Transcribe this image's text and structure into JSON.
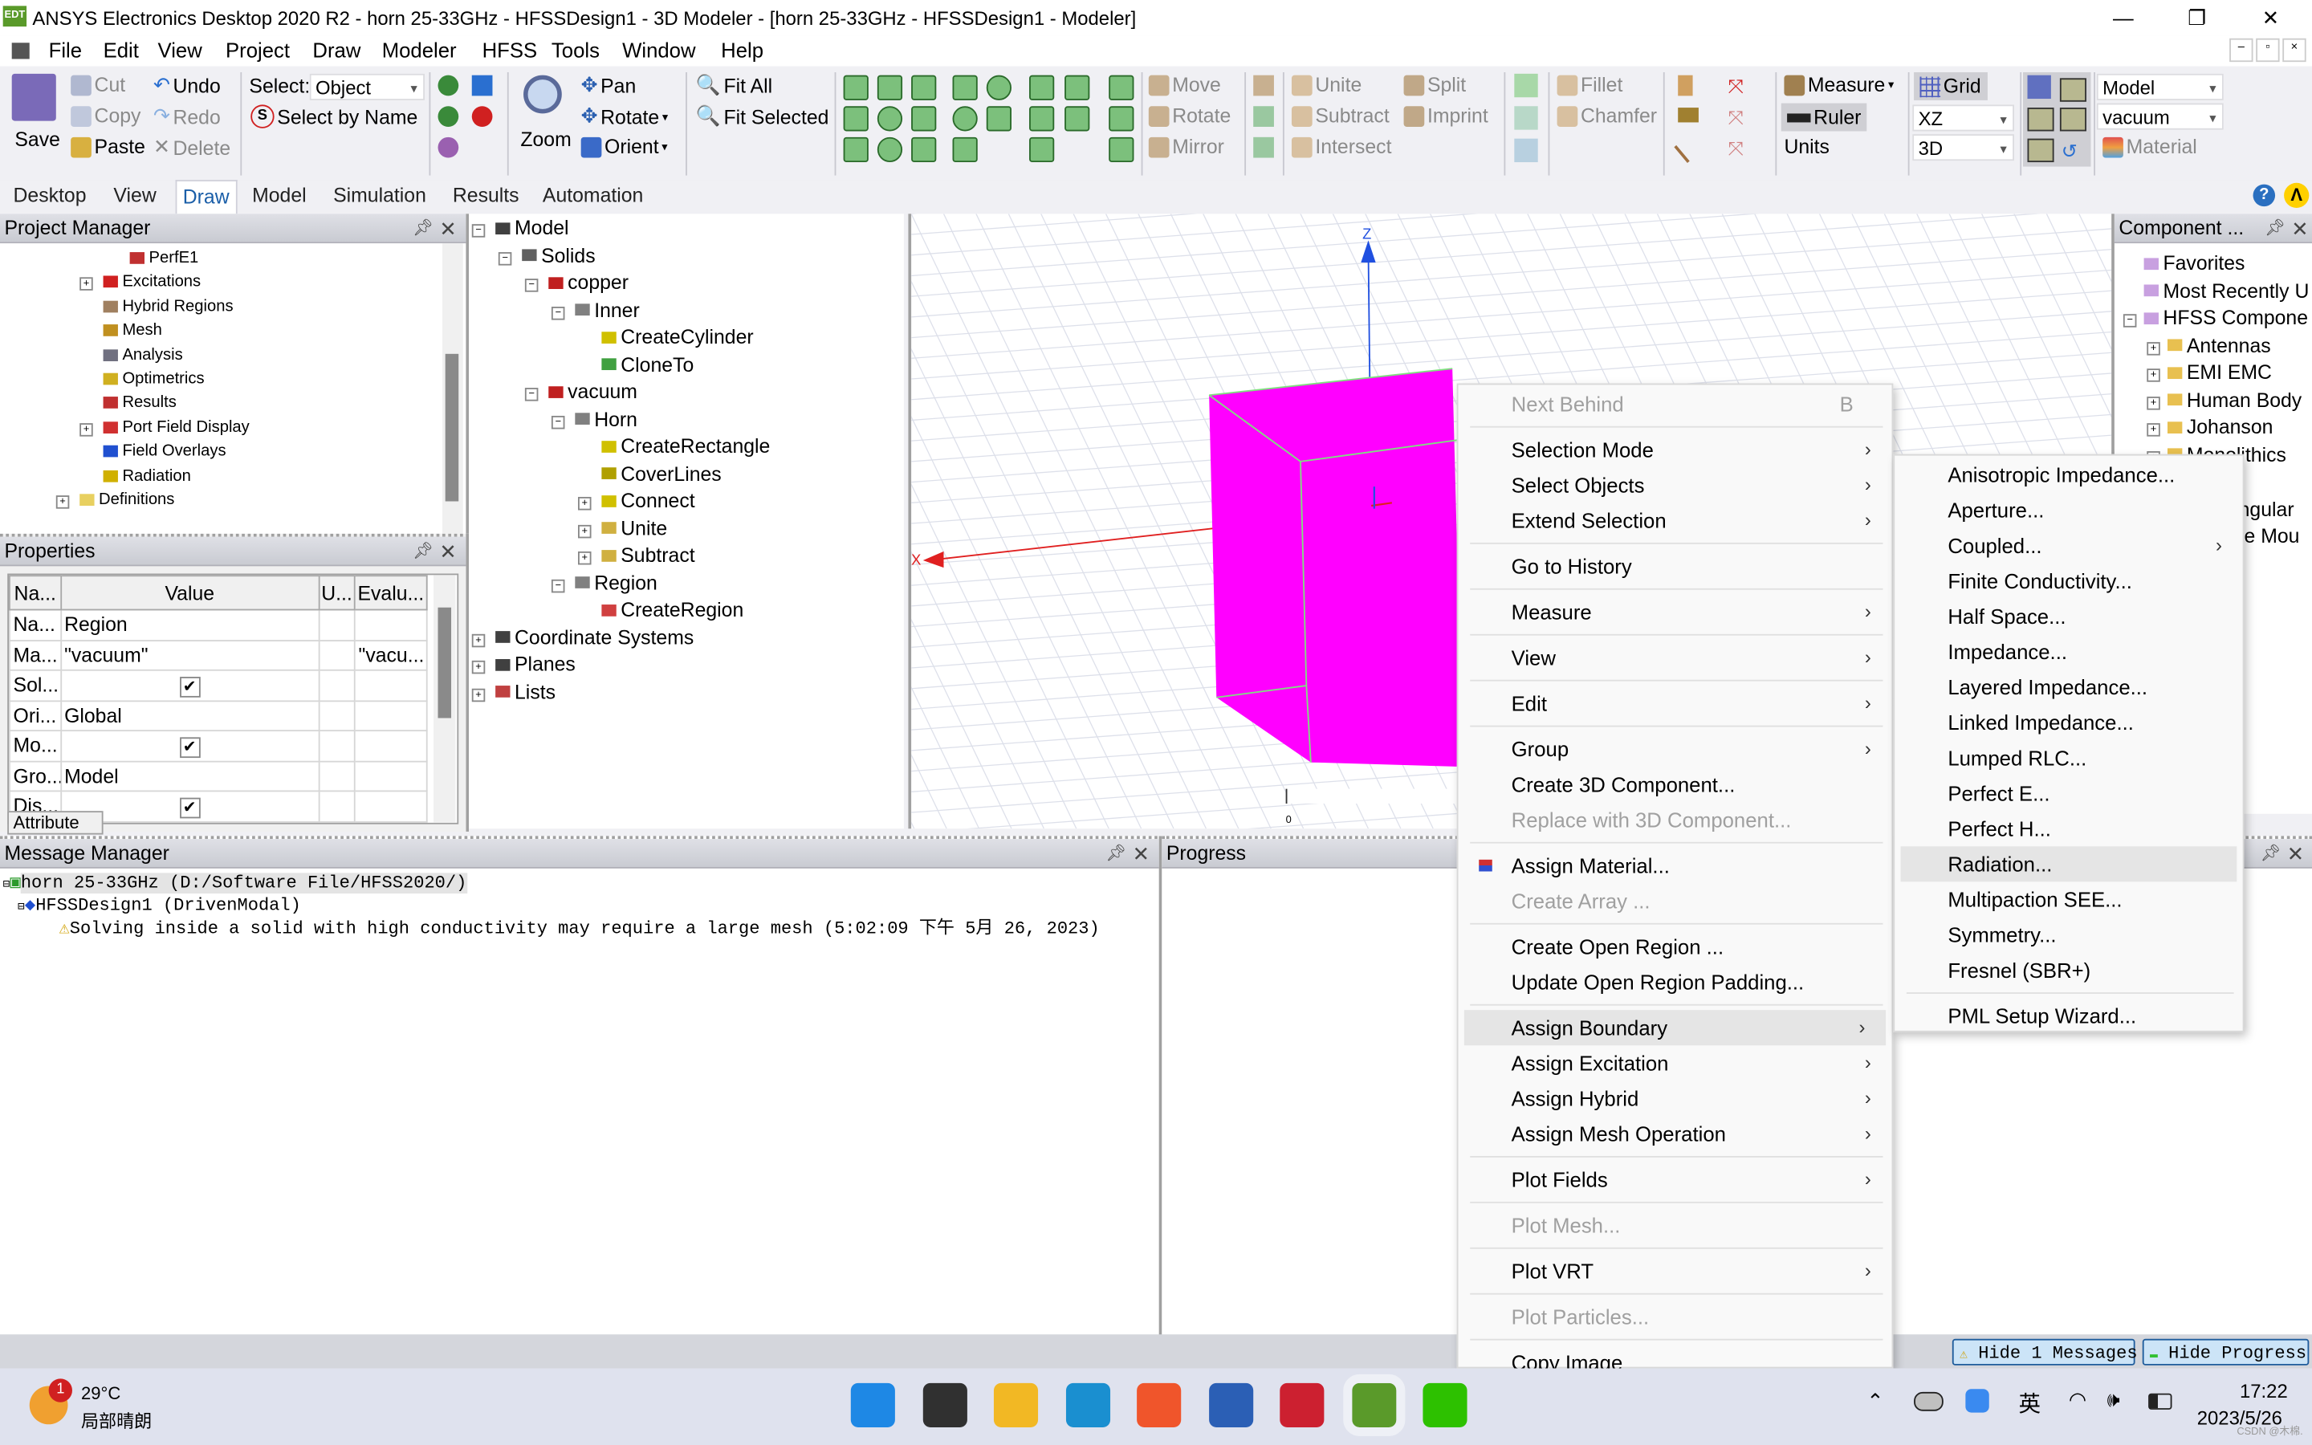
{
  "window": {
    "title": "ANSYS Electronics Desktop 2020 R2 - horn 25-33GHz - HFSSDesign1 - 3D Modeler - [horn 25-33GHz - HFSSDesign1 - Modeler]",
    "app_icon_text": "EDT",
    "minimize": "—",
    "restore": "❐",
    "close": "✕"
  },
  "menu": [
    "File",
    "Edit",
    "View",
    "Project",
    "Draw",
    "Modeler",
    "HFSS",
    "Tools",
    "Window",
    "Help"
  ],
  "ribbon": {
    "save": "Save",
    "cut": "Cut",
    "copy": "Copy",
    "paste": "Paste",
    "undo": "Undo",
    "redo": "Redo",
    "delete": "Delete",
    "select_label": "Select:",
    "select_value": "Object",
    "select_by_name": "Select by Name",
    "zoom": "Zoom",
    "pan": "Pan",
    "rotate": "Rotate",
    "orient": "Orient",
    "fit_all": "Fit All",
    "fit_selected": "Fit Selected",
    "move": "Move",
    "rotate2": "Rotate",
    "mirror": "Mirror",
    "unite": "Unite",
    "subtract": "Subtract",
    "intersect": "Intersect",
    "split": "Split",
    "imprint": "Imprint",
    "fillet": "Fillet",
    "chamfer": "Chamfer",
    "measure": "Measure",
    "ruler": "Ruler",
    "units": "Units",
    "grid": "Grid",
    "plane_value": "XZ",
    "view_value": "3D",
    "model_value": "Model",
    "material_value": "vacuum",
    "material": "Material"
  },
  "tabs": [
    {
      "label": "Desktop",
      "active": false
    },
    {
      "label": "View",
      "active": false
    },
    {
      "label": "Draw",
      "active": true
    },
    {
      "label": "Model",
      "active": false
    },
    {
      "label": "Simulation",
      "active": false
    },
    {
      "label": "Results",
      "active": false
    },
    {
      "label": "Automation",
      "active": false
    }
  ],
  "project_manager": {
    "title": "Project Manager",
    "items": [
      {
        "label": "PerfE1",
        "level": 3,
        "color": "#c03030"
      },
      {
        "label": "Excitations",
        "level": 2,
        "expandable": true,
        "color": "#d02020"
      },
      {
        "label": "Hybrid Regions",
        "level": 2,
        "color": "#a08060"
      },
      {
        "label": "Mesh",
        "level": 2,
        "color": "#c09020"
      },
      {
        "label": "Analysis",
        "level": 2,
        "color": "#707080"
      },
      {
        "label": "Optimetrics",
        "level": 2,
        "color": "#d0b020"
      },
      {
        "label": "Results",
        "level": 2,
        "color": "#c03030"
      },
      {
        "label": "Port Field Display",
        "level": 2,
        "expandable": true,
        "color": "#d03030"
      },
      {
        "label": "Field Overlays",
        "level": 2,
        "color": "#2050d0"
      },
      {
        "label": "Radiation",
        "level": 2,
        "color": "#d0b000"
      },
      {
        "label": "Definitions",
        "level": 1,
        "expandable": true,
        "color": "#e8d060"
      }
    ]
  },
  "properties": {
    "title": "Properties",
    "columns": [
      "Na...",
      "Value",
      "U...",
      "Evalu..."
    ],
    "rows": [
      {
        "name": "Na...",
        "value": "Region",
        "unit": "",
        "eval": ""
      },
      {
        "name": "Ma...",
        "value": "\"vacuum\"",
        "unit": "",
        "eval": "\"vacu..."
      },
      {
        "name": "Sol...",
        "checked": true,
        "unit": "",
        "eval": ""
      },
      {
        "name": "Ori...",
        "value": "Global",
        "unit": "",
        "eval": ""
      },
      {
        "name": "Mo...",
        "checked": true,
        "unit": "",
        "eval": ""
      },
      {
        "name": "Gro...",
        "value": "Model",
        "unit": "",
        "eval": ""
      },
      {
        "name": "Dis...",
        "checked": true,
        "unit": "",
        "eval": ""
      }
    ],
    "tab": "Attribute"
  },
  "model_tree": [
    {
      "label": "Model",
      "level": 0,
      "expandable": true,
      "color": "#404040"
    },
    {
      "label": "Solids",
      "level": 1,
      "expandable": true,
      "color": "#606060"
    },
    {
      "label": "copper",
      "level": 2,
      "expandable": true,
      "color": "#c02020"
    },
    {
      "label": "Inner",
      "level": 3,
      "expandable": true,
      "color": "#808080"
    },
    {
      "label": "CreateCylinder",
      "level": 4,
      "color": "#d0c000"
    },
    {
      "label": "CloneTo",
      "level": 4,
      "color": "#40a040"
    },
    {
      "label": "vacuum",
      "level": 2,
      "expandable": true,
      "color": "#c02020"
    },
    {
      "label": "Horn",
      "level": 3,
      "expandable": true,
      "color": "#808080"
    },
    {
      "label": "CreateRectangle",
      "level": 4,
      "color": "#d0c000"
    },
    {
      "label": "CoverLines",
      "level": 4,
      "color": "#b0a000"
    },
    {
      "label": "Connect",
      "level": 4,
      "expandable": true,
      "color": "#d0c000"
    },
    {
      "label": "Unite",
      "level": 4,
      "expandable": true,
      "color": "#d0b040"
    },
    {
      "label": "Subtract",
      "level": 4,
      "expandable": true,
      "color": "#d0b040"
    },
    {
      "label": "Region",
      "level": 3,
      "expandable": true,
      "color": "#808080"
    },
    {
      "label": "CreateRegion",
      "level": 4,
      "color": "#d04040"
    },
    {
      "label": "Coordinate Systems",
      "level": 0,
      "expandable": true,
      "color": "#404040"
    },
    {
      "label": "Planes",
      "level": 0,
      "expandable": true,
      "color": "#404040"
    },
    {
      "label": "Lists",
      "level": 0,
      "expandable": true,
      "color": "#c04040"
    }
  ],
  "viewport": {
    "axis_z": "Z",
    "axis_x": "X",
    "scale_zero": "0",
    "object_color": "#ff00ff"
  },
  "component_panel": {
    "title": "Component ...",
    "items": [
      {
        "label": "Favorites",
        "level": 0
      },
      {
        "label": "Most Recently U",
        "level": 0
      },
      {
        "label": "HFSS Compone",
        "level": 0,
        "expandable": true
      },
      {
        "label": "Antennas",
        "level": 1,
        "expandable": true
      },
      {
        "label": "EMI EMC",
        "level": 1,
        "expandable": true
      },
      {
        "label": "Human Body",
        "level": 1,
        "expandable": true
      },
      {
        "label": "Johanson",
        "level": 1,
        "expandable": true
      },
      {
        "label": "Monolithics",
        "level": 1,
        "expandable": true
      },
      {
        "label": "",
        "level": 1
      },
      {
        "label": "Rectangular",
        "level": 1,
        "expandable": true
      },
      {
        "label": "Surface Mou",
        "level": 1,
        "expandable": true
      }
    ]
  },
  "context_menu": [
    {
      "label": "Next Behind",
      "disabled": true,
      "shortcut": "B"
    },
    {
      "sep": true
    },
    {
      "label": "Selection Mode",
      "submenu": true
    },
    {
      "label": "Select Objects",
      "submenu": true
    },
    {
      "label": "Extend Selection",
      "submenu": true
    },
    {
      "sep": true
    },
    {
      "label": "Go to History"
    },
    {
      "sep": true
    },
    {
      "label": "Measure",
      "submenu": true
    },
    {
      "sep": true
    },
    {
      "label": "View",
      "submenu": true
    },
    {
      "sep": true
    },
    {
      "label": "Edit",
      "submenu": true
    },
    {
      "sep": true
    },
    {
      "label": "Group",
      "submenu": true
    },
    {
      "label": "Create 3D Component..."
    },
    {
      "label": "Replace with 3D Component...",
      "disabled": true
    },
    {
      "sep": true
    },
    {
      "label": "Assign Material...",
      "icon": "material-icon"
    },
    {
      "label": "Create Array ...",
      "disabled": true
    },
    {
      "sep": true
    },
    {
      "label": "Create Open Region ..."
    },
    {
      "label": "Update Open Region Padding..."
    },
    {
      "sep": true
    },
    {
      "label": "Assign Boundary",
      "submenu": true,
      "highlighted": true
    },
    {
      "label": "Assign Excitation",
      "submenu": true
    },
    {
      "label": "Assign Hybrid",
      "submenu": true
    },
    {
      "label": "Assign Mesh Operation",
      "submenu": true
    },
    {
      "sep": true
    },
    {
      "label": "Plot Fields",
      "submenu": true
    },
    {
      "sep": true
    },
    {
      "label": "Plot Mesh...",
      "disabled": true
    },
    {
      "sep": true
    },
    {
      "label": "Plot VRT",
      "submenu": true
    },
    {
      "sep": true
    },
    {
      "label": "Plot Particles...",
      "disabled": true
    },
    {
      "sep": true
    },
    {
      "label": "Copy Image"
    }
  ],
  "boundary_submenu": [
    {
      "label": "Anisotropic Impedance..."
    },
    {
      "label": "Aperture..."
    },
    {
      "label": "Coupled...",
      "submenu": true
    },
    {
      "label": "Finite Conductivity..."
    },
    {
      "label": "Half Space..."
    },
    {
      "label": "Impedance..."
    },
    {
      "label": "Layered Impedance..."
    },
    {
      "label": "Linked Impedance..."
    },
    {
      "label": "Lumped RLC..."
    },
    {
      "label": "Perfect E..."
    },
    {
      "label": "Perfect H..."
    },
    {
      "label": "Radiation...",
      "highlighted": true
    },
    {
      "label": "Multipaction SEE..."
    },
    {
      "label": "Symmetry..."
    },
    {
      "label": "Fresnel (SBR+)"
    },
    {
      "sep": true
    },
    {
      "label": "PML Setup Wizard..."
    }
  ],
  "message_manager": {
    "title": "Message Manager",
    "project": "horn 25-33GHz (D:/Software File/HFSS2020/)",
    "design": "HFSSDesign1 (DrivenModal)",
    "warning": "Solving inside a solid with high conductivity may require a large mesh (5:02:09 下午  5月 26, 2023)"
  },
  "progress": {
    "title": "Progress"
  },
  "status": {
    "hide_messages": "Hide 1 Messages",
    "hide_progress": "Hide Progress"
  },
  "taskbar": {
    "weather_temp": "29°C",
    "weather_desc": "局部晴朗",
    "weather_badge": "1",
    "ime": "英",
    "time": "17:22",
    "date": "2023/5/26",
    "watermark": "CSDN @木棉.",
    "apps": [
      {
        "name": "start",
        "color": "#1e88e5"
      },
      {
        "name": "task-view",
        "color": "#303030"
      },
      {
        "name": "file-explorer",
        "color": "#f2b824"
      },
      {
        "name": "edge",
        "color": "#1a8fd0"
      },
      {
        "name": "video-app",
        "color": "#f0552b"
      },
      {
        "name": "word",
        "color": "#2b5fb5"
      },
      {
        "name": "zy-app",
        "color": "#cc2030"
      },
      {
        "name": "ansys-edt",
        "color": "#5a9a2a"
      },
      {
        "name": "wechat",
        "color": "#2dc100"
      }
    ]
  }
}
